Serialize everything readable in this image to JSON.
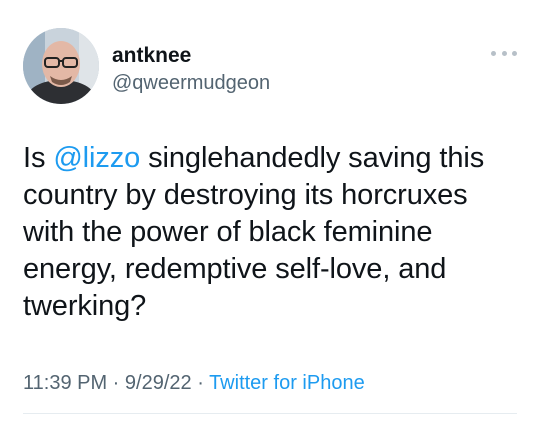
{
  "user": {
    "display_name": "antknee",
    "handle": "@qweermudgeon"
  },
  "tweet": {
    "text_before": "Is ",
    "mention": "@lizzo",
    "text_after": " singlehandedly saving this country by destroying its horcruxes with the power of black feminine energy, redemptive self-love, and twerking?"
  },
  "meta": {
    "time": "11:39 PM",
    "sep1": " · ",
    "date": "9/29/22",
    "sep2": " · ",
    "source": "Twitter for iPhone"
  },
  "icons": {
    "more": "more-horizontal-icon"
  },
  "colors": {
    "link": "#1d9bf0",
    "secondary_text": "#536471",
    "primary_text": "#0f1419"
  }
}
